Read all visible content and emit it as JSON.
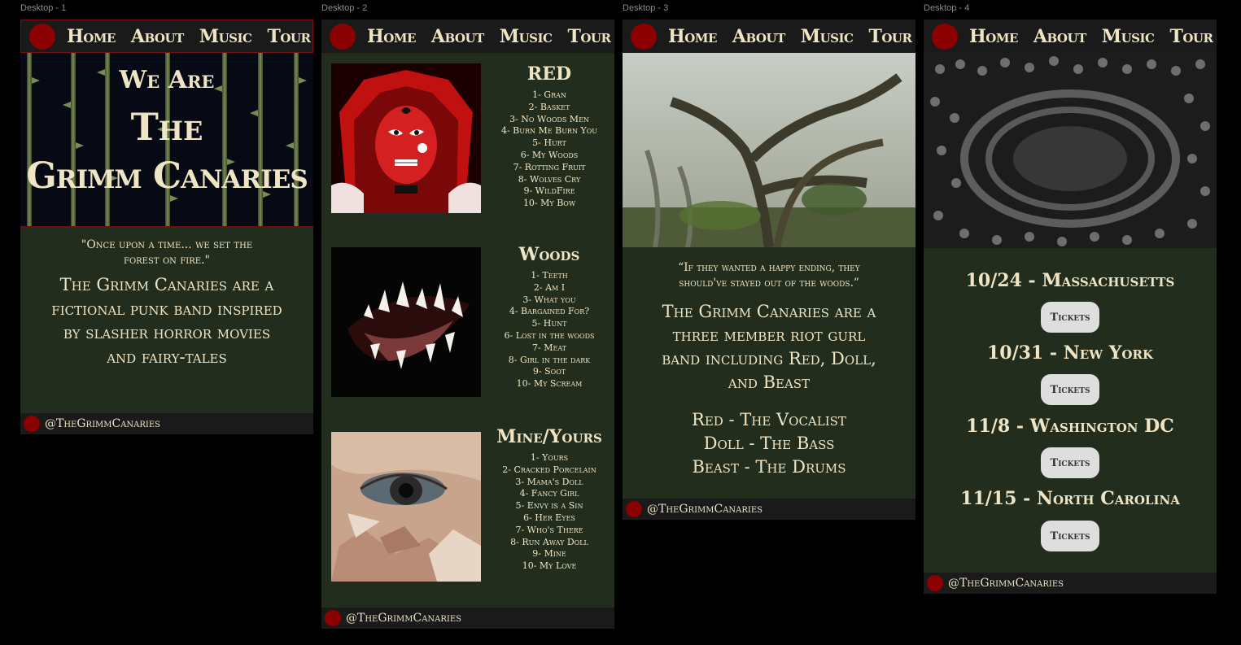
{
  "frames": [
    {
      "label": "Desktop - 1"
    },
    {
      "label": "Desktop - 2"
    },
    {
      "label": "Desktop - 3"
    },
    {
      "label": "Desktop - 4"
    }
  ],
  "nav": {
    "home": "Home",
    "about": "About",
    "music": "Music",
    "tour": "Tour"
  },
  "footer": {
    "handle": "@TheGrimmCanaries"
  },
  "home": {
    "hero_line1": "We Are",
    "hero_line2": "The",
    "hero_line3": "Grimm Canaries",
    "quote": "\"Once upon a time... we set the forest on fire.\"",
    "intro": "The Grimm Canaries are a fictional punk band inspired by slasher horror movies and fairy-tales"
  },
  "music": {
    "albums": [
      {
        "title": "RED",
        "tracks": [
          "1- Gran",
          "2- Basket",
          "3- No Woods Men",
          "4- Burn Me Burn You",
          "5- Hurt",
          "6- My Woods",
          "7- Rotting Fruit",
          "8- Wolves Cry",
          "9- WildFire",
          "10- My Bow"
        ]
      },
      {
        "title": "Woods",
        "tracks": [
          "1- Teeth",
          "2- Am I",
          "3- What you",
          "4- Bargained For?",
          "5- Hunt",
          "6- Lost in the woods",
          "7- Meat",
          "8- Girl in the dark",
          "9- Soot",
          "10- My Scream"
        ]
      },
      {
        "title": "Mine/Yours",
        "tracks": [
          "1- Yours",
          "2- Cracked Porcelain",
          "3- Mama's Doll",
          "4- Fancy Girl",
          "5- Envy is a Sin",
          "6- Her Eyes",
          "7- Who's There",
          "8- Run Away Doll",
          "9- Mine",
          "10- My Love"
        ]
      }
    ]
  },
  "about": {
    "quote": "“If they wanted a happy ending, they should've stayed out of the woods.”",
    "intro": "The Grimm Canaries are a three member riot gurl band including Red, Doll, and Beast",
    "members": [
      "Red - The Vocalist",
      "Doll - The Bass",
      "Beast - The Drums"
    ]
  },
  "tour": {
    "ticket_label": "Tickets",
    "dates": [
      "10/24 - Massachusetts",
      "10/31 - New York",
      "11/8 - Washington DC",
      "11/15 - North Carolina"
    ]
  }
}
